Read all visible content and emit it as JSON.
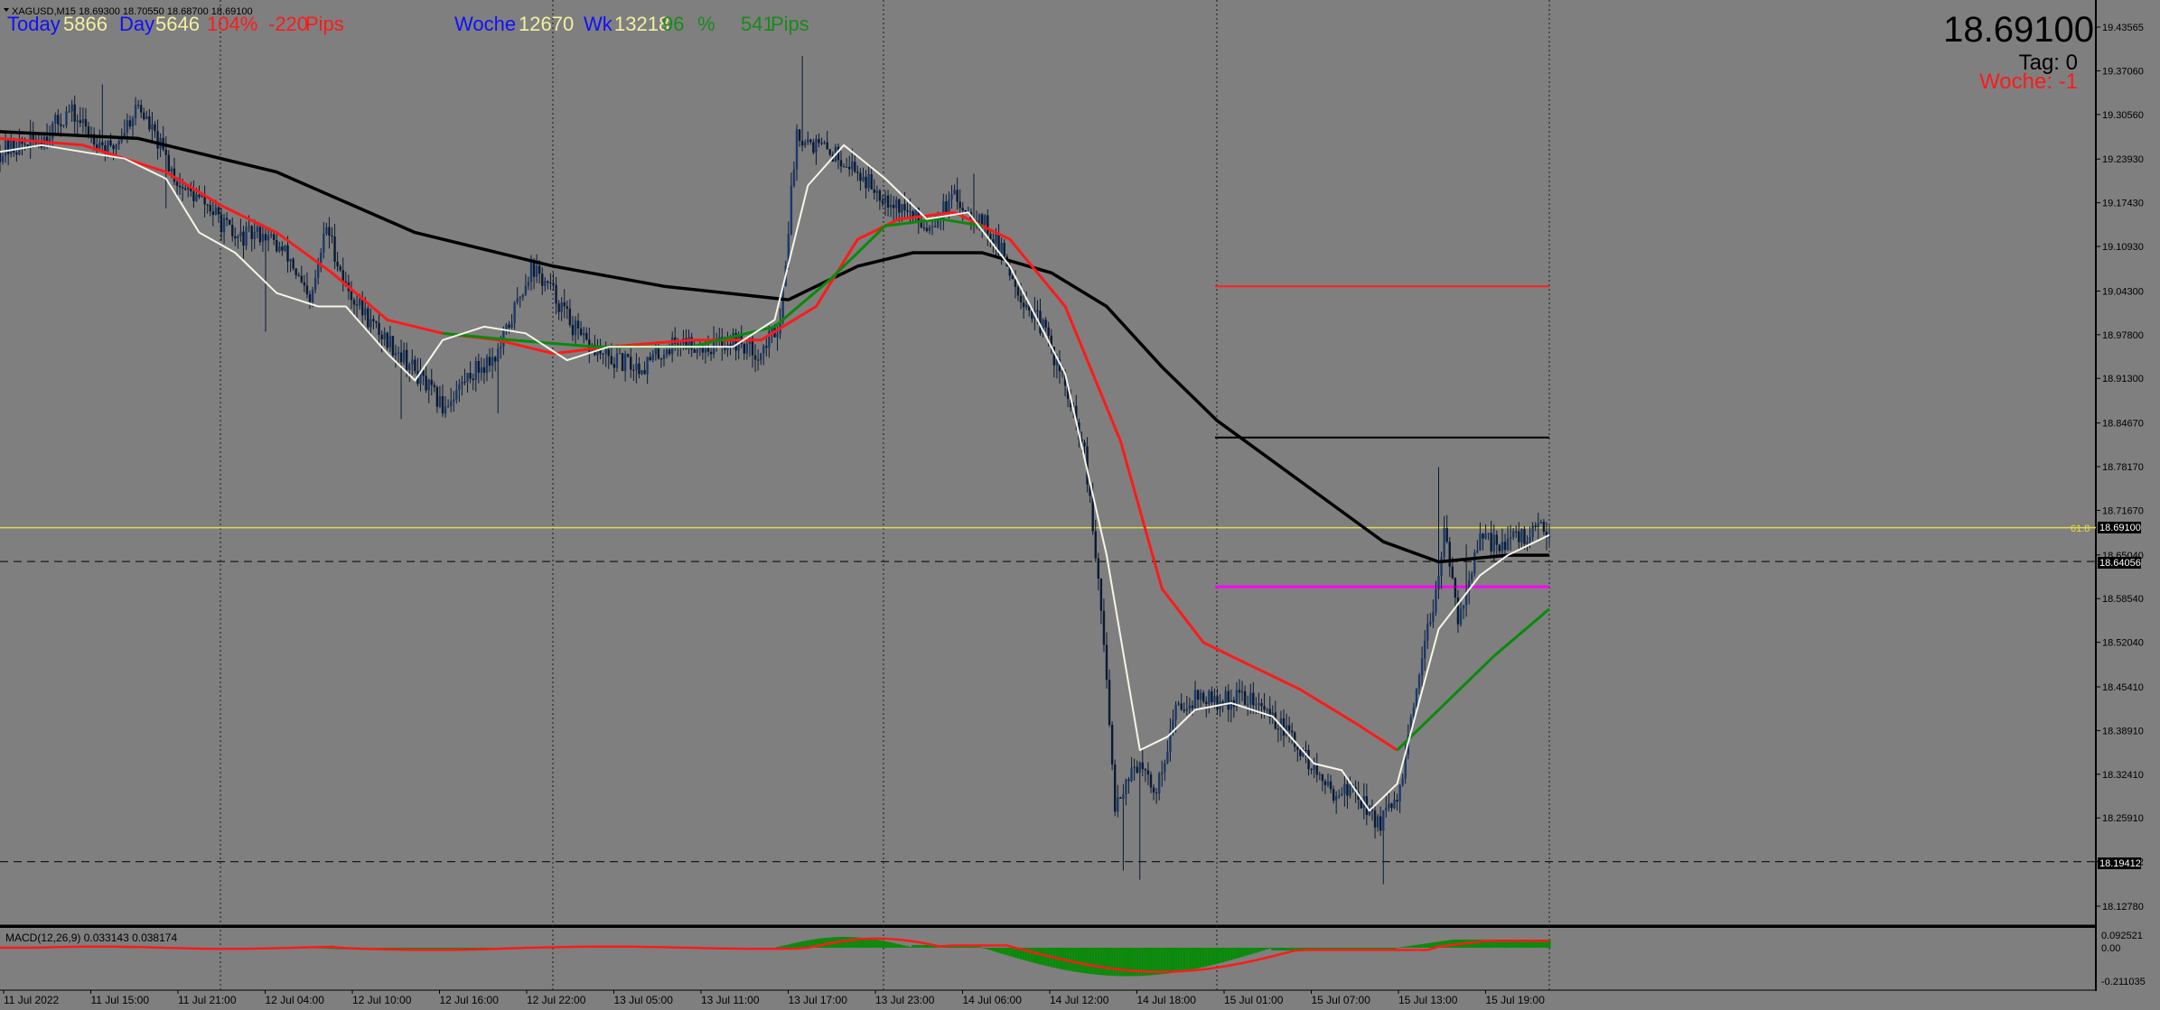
{
  "window": {
    "title": "XAGUSD,M15  18.69300 18.70550 18.68700 18.69100"
  },
  "stats": {
    "today_label": "Today",
    "today_value": "5866",
    "day_label": "Day",
    "day_value": "5646",
    "day_percent": "104%",
    "day_pips": "-220",
    "pips_label": "Pips",
    "week_label": "Woche",
    "week_value": "12670",
    "wk_label": "Wk",
    "wk_value": "13218",
    "wk_percent": "96",
    "percent_sign": "%",
    "wk_pips": "541",
    "wk_pips_label": "Pips"
  },
  "price_display": {
    "price": "18.69100",
    "tag_label": "Tag:  0",
    "woche_label": "Woche: -1"
  },
  "price_axis": {
    "ticks": [
      "19.43565",
      "19.37060",
      "19.30560",
      "19.23930",
      "19.17430",
      "19.10930",
      "19.04300",
      "18.97800",
      "18.91300",
      "18.84670",
      "18.78170",
      "18.71670",
      "18.65040",
      "18.58540",
      "18.52040",
      "18.45410",
      "18.38910",
      "18.32410",
      "18.25910",
      "18.19412",
      "18.12780"
    ],
    "tick_values": [
      19.43565,
      19.3706,
      19.3056,
      19.2393,
      19.1743,
      19.1093,
      19.043,
      18.978,
      18.913,
      18.8467,
      18.7817,
      18.7167,
      18.6504,
      18.5854,
      18.5204,
      18.4541,
      18.3891,
      18.3241,
      18.2591,
      18.19412,
      18.1278
    ],
    "current_price_tag": "18.69100",
    "level_tag_1": "18.64056",
    "level_tag_2": "18.19412",
    "fib_label": "61.8"
  },
  "time_axis": {
    "labels": [
      "11 Jul 2022",
      "11 Jul 15:00",
      "11 Jul 21:00",
      "12 Jul 04:00",
      "12 Jul 10:00",
      "12 Jul 16:00",
      "12 Jul 22:00",
      "13 Jul 05:00",
      "13 Jul 11:00",
      "13 Jul 17:00",
      "13 Jul 23:00",
      "14 Jul 06:00",
      "14 Jul 12:00",
      "14 Jul 18:00",
      "15 Jul 01:00",
      "15 Jul 07:00",
      "15 Jul 13:00",
      "15 Jul 19:00"
    ]
  },
  "macd": {
    "label": "MACD(12,26,9) 0.033143 0.038174",
    "axis_ticks": [
      "0.092521",
      "0.00",
      "-0.211035"
    ]
  },
  "chart_data": {
    "type": "candlestick",
    "symbol": "XAGUSD",
    "timeframe": "M15",
    "ohlc_current": {
      "open": 18.693,
      "high": 18.7055,
      "low": 18.687,
      "close": 18.691
    },
    "ylim": [
      18.09,
      19.468
    ],
    "price_path": [
      [
        0,
        19.25
      ],
      [
        15,
        19.27
      ],
      [
        25,
        19.31
      ],
      [
        40,
        19.25
      ],
      [
        50,
        19.32
      ],
      [
        65,
        19.2
      ],
      [
        75,
        19.17
      ],
      [
        85,
        19.12
      ],
      [
        95,
        19.13
      ],
      [
        105,
        19.09
      ],
      [
        112,
        19.02
      ],
      [
        118,
        19.14
      ],
      [
        125,
        19.05
      ],
      [
        135,
        18.99
      ],
      [
        145,
        18.95
      ],
      [
        160,
        18.87
      ],
      [
        170,
        18.92
      ],
      [
        180,
        18.95
      ],
      [
        192,
        19.08
      ],
      [
        200,
        19.04
      ],
      [
        210,
        18.97
      ],
      [
        220,
        18.94
      ],
      [
        232,
        18.93
      ],
      [
        245,
        18.97
      ],
      [
        255,
        18.96
      ],
      [
        265,
        18.97
      ],
      [
        275,
        18.95
      ],
      [
        282,
        19.0
      ],
      [
        288,
        19.28
      ],
      [
        295,
        19.26
      ],
      [
        305,
        19.24
      ],
      [
        315,
        19.2
      ],
      [
        325,
        19.17
      ],
      [
        335,
        19.14
      ],
      [
        345,
        19.18
      ],
      [
        355,
        19.15
      ],
      [
        362,
        19.1
      ],
      [
        370,
        19.03
      ],
      [
        378,
        18.98
      ],
      [
        385,
        18.9
      ],
      [
        392,
        18.8
      ],
      [
        398,
        18.57
      ],
      [
        403,
        18.28
      ],
      [
        410,
        18.34
      ],
      [
        418,
        18.3
      ],
      [
        425,
        18.42
      ],
      [
        432,
        18.44
      ],
      [
        440,
        18.43
      ],
      [
        450,
        18.44
      ],
      [
        460,
        18.41
      ],
      [
        470,
        18.36
      ],
      [
        480,
        18.3
      ],
      [
        490,
        18.3
      ],
      [
        498,
        18.25
      ],
      [
        505,
        18.28
      ],
      [
        512,
        18.44
      ],
      [
        518,
        18.58
      ],
      [
        522,
        18.68
      ],
      [
        527,
        18.56
      ],
      [
        535,
        18.67
      ],
      [
        545,
        18.67
      ],
      [
        552,
        18.68
      ],
      [
        560,
        18.69
      ]
    ],
    "moving_averages": {
      "white_fast": [
        [
          0,
          19.25
        ],
        [
          15,
          19.26
        ],
        [
          30,
          19.25
        ],
        [
          45,
          19.24
        ],
        [
          60,
          19.21
        ],
        [
          72,
          19.13
        ],
        [
          85,
          19.1
        ],
        [
          100,
          19.04
        ],
        [
          115,
          19.02
        ],
        [
          125,
          19.02
        ],
        [
          140,
          18.95
        ],
        [
          150,
          18.91
        ],
        [
          160,
          18.97
        ],
        [
          175,
          18.99
        ],
        [
          190,
          18.98
        ],
        [
          205,
          18.94
        ],
        [
          220,
          18.96
        ],
        [
          235,
          18.96
        ],
        [
          250,
          18.96
        ],
        [
          265,
          18.96
        ],
        [
          280,
          19.0
        ],
        [
          292,
          19.2
        ],
        [
          305,
          19.26
        ],
        [
          320,
          19.21
        ],
        [
          335,
          19.15
        ],
        [
          350,
          19.16
        ],
        [
          365,
          19.08
        ],
        [
          385,
          18.92
        ],
        [
          400,
          18.65
        ],
        [
          412,
          18.36
        ],
        [
          422,
          18.38
        ],
        [
          432,
          18.42
        ],
        [
          445,
          18.43
        ],
        [
          460,
          18.41
        ],
        [
          475,
          18.34
        ],
        [
          485,
          18.33
        ],
        [
          495,
          18.27
        ],
        [
          505,
          18.31
        ],
        [
          520,
          18.54
        ],
        [
          535,
          18.62
        ],
        [
          545,
          18.65
        ],
        [
          560,
          18.68
        ]
      ],
      "red_medium": [
        [
          0,
          19.27
        ],
        [
          30,
          19.26
        ],
        [
          60,
          19.22
        ],
        [
          80,
          19.17
        ],
        [
          100,
          19.13
        ],
        [
          120,
          19.07
        ],
        [
          140,
          19.0
        ],
        [
          160,
          18.98
        ],
        [
          180,
          18.97
        ],
        [
          200,
          18.95
        ],
        [
          220,
          18.96
        ],
        [
          250,
          18.97
        ],
        [
          275,
          18.97
        ],
        [
          295,
          19.02
        ],
        [
          310,
          19.12
        ],
        [
          325,
          19.15
        ],
        [
          345,
          19.16
        ],
        [
          365,
          19.12
        ],
        [
          385,
          19.02
        ],
        [
          405,
          18.82
        ],
        [
          420,
          18.6
        ],
        [
          435,
          18.52
        ],
        [
          450,
          18.49
        ],
        [
          470,
          18.45
        ],
        [
          490,
          18.4
        ],
        [
          505,
          18.36
        ]
      ],
      "green_medium": [
        [
          160,
          18.98
        ],
        [
          185,
          18.97
        ],
        [
          215,
          18.96
        ],
        [
          250,
          18.96
        ],
        [
          280,
          18.99
        ],
        [
          300,
          19.06
        ],
        [
          320,
          19.14
        ],
        [
          340,
          19.15
        ],
        [
          355,
          19.14
        ],
        [
          505,
          18.36
        ],
        [
          520,
          18.42
        ],
        [
          540,
          18.5
        ],
        [
          560,
          18.57
        ]
      ],
      "black_slow": [
        [
          0,
          19.28
        ],
        [
          50,
          19.27
        ],
        [
          100,
          19.22
        ],
        [
          150,
          19.13
        ],
        [
          200,
          19.08
        ],
        [
          240,
          19.05
        ],
        [
          285,
          19.03
        ],
        [
          310,
          19.08
        ],
        [
          330,
          19.1
        ],
        [
          355,
          19.1
        ],
        [
          380,
          19.07
        ],
        [
          400,
          19.02
        ],
        [
          420,
          18.93
        ],
        [
          440,
          18.85
        ],
        [
          460,
          18.79
        ],
        [
          480,
          18.73
        ],
        [
          500,
          18.67
        ],
        [
          520,
          18.64
        ],
        [
          545,
          18.65
        ],
        [
          560,
          18.65
        ]
      ]
    },
    "horizontal_levels": [
      {
        "name": "yellow-level",
        "price": 18.691,
        "color": "#e8d84a"
      },
      {
        "name": "dashed-upper",
        "price": 18.64056,
        "color": "#1a1a1a"
      },
      {
        "name": "dashed-lower",
        "price": 18.19412,
        "color": "#1a1a1a"
      },
      {
        "name": "red-level",
        "price": 19.05,
        "color": "#ff2020"
      },
      {
        "name": "black-level",
        "price": 18.825,
        "color": "#000000"
      },
      {
        "name": "magenta-level",
        "price": 18.603,
        "color": "#ff00ff"
      }
    ],
    "grid": "vertical-dotted",
    "colors": {
      "background": "#7f7f7f",
      "candle": "#0a1a33",
      "text_blue": "#1010ff",
      "text_yellow": "#f2f0a0",
      "text_red": "#ff1a1a",
      "text_green": "#1a8a1a",
      "macd_hist": "#0a8a0a",
      "macd_signal": "#ff1a1a"
    }
  }
}
